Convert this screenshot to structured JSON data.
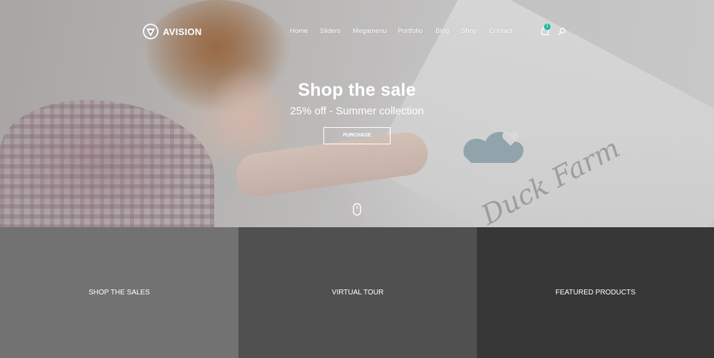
{
  "brand": {
    "name": "AVISION"
  },
  "nav": {
    "items": [
      {
        "label": "Home"
      },
      {
        "label": "Sliders"
      },
      {
        "label": "Megamenu"
      },
      {
        "label": "Portfolio"
      },
      {
        "label": "Blog"
      },
      {
        "label": "Shop"
      },
      {
        "label": "Contact"
      }
    ],
    "cart_count": "1",
    "cart_icon": "shopping-bag-icon",
    "search_icon": "search-icon"
  },
  "hero": {
    "title": "Shop the sale",
    "subtitle": "25% off - Summer collection",
    "cta_label": "PURCHASE",
    "image_text": "Duck Farm",
    "scroll_icon": "mouse-icon"
  },
  "tiles": [
    {
      "label": "SHOP THE SALES"
    },
    {
      "label": "VIRTUAL TOUR"
    },
    {
      "label": "FEATURED PRODUCTS"
    }
  ],
  "colors": {
    "accent": "#1bbc9b",
    "tile_1": "#727272",
    "tile_2": "#505050",
    "tile_3": "#373737"
  }
}
